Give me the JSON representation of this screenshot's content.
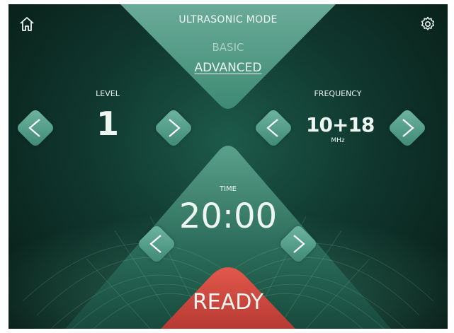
{
  "header": {
    "title": "ULTRASONIC MODE"
  },
  "icons": {
    "home": "home-icon",
    "settings": "gear-icon"
  },
  "mode": {
    "options": [
      "BASIC",
      "ADVANCED"
    ],
    "selected": "ADVANCED"
  },
  "level": {
    "label": "LEVEL",
    "value": "1"
  },
  "frequency": {
    "label": "FREQUENCY",
    "value": "10+18",
    "unit": "MHz"
  },
  "time": {
    "label": "TIME",
    "value": "20:00"
  },
  "status": {
    "label": "READY"
  },
  "colors": {
    "accent": "#5fa896",
    "ready": "#d9534a",
    "background": "#10382e",
    "text": "#eef6f2"
  }
}
